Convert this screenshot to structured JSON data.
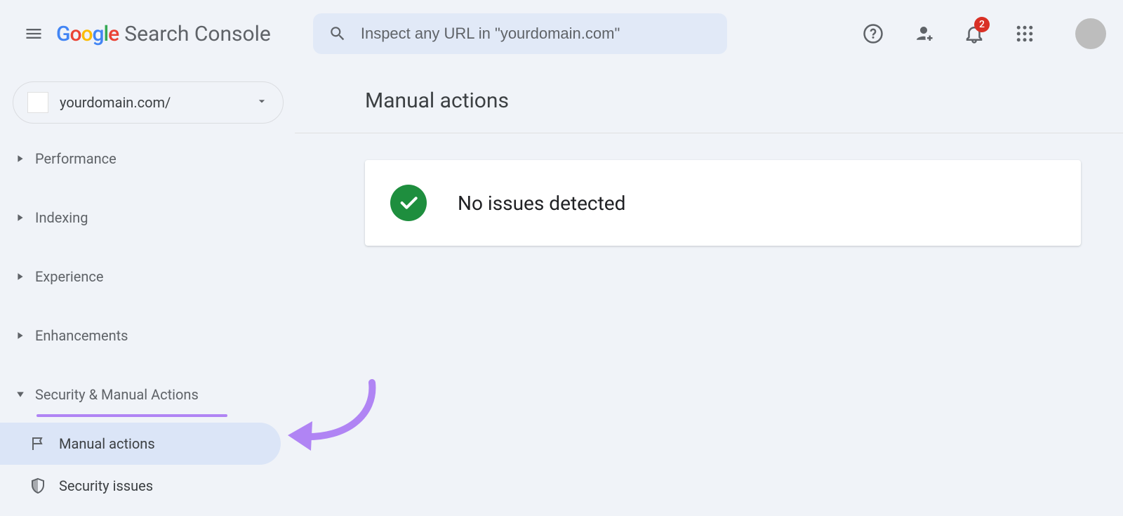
{
  "header": {
    "logo_suffix": "Search Console",
    "search_placeholder": "Inspect any URL in \"yourdomain.com\"",
    "notification_count": "2"
  },
  "sidebar": {
    "property": "yourdomain.com/",
    "sections": {
      "performance": "Performance",
      "indexing": "Indexing",
      "experience": "Experience",
      "enhancements": "Enhancements",
      "security": "Security & Manual Actions"
    },
    "items": {
      "manual_actions": "Manual actions",
      "security_issues": "Security issues"
    }
  },
  "main": {
    "title": "Manual actions",
    "status": "No issues detected"
  }
}
